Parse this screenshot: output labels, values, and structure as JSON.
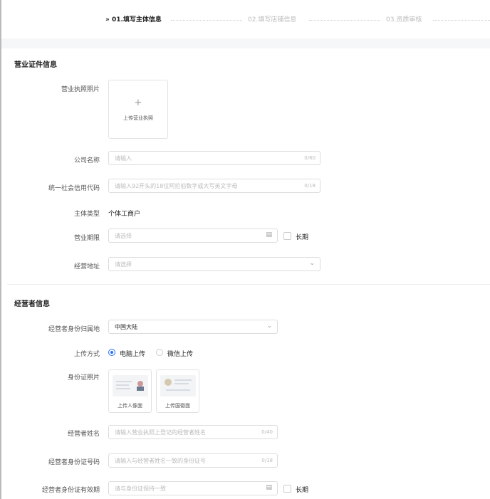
{
  "steps": [
    {
      "label": "» 01.填写主体信息"
    },
    {
      "label": "02.填写店铺信息"
    },
    {
      "label": "03.资质审核"
    }
  ],
  "business": {
    "section_title": "营业证件信息",
    "license_photo_label": "营业执照照片",
    "license_upload_plus": "+",
    "license_upload_text": "上传营业执照",
    "company_name_label": "公司名称",
    "company_name_placeholder": "请输入",
    "company_name_count": "0/60",
    "credit_code_label": "统一社会信用代码",
    "credit_code_placeholder": "请输入92开头的18位阿拉伯数字或大写英文字母",
    "credit_code_count": "0/18",
    "entity_type_label": "主体类型",
    "entity_type_value": "个体工商户",
    "term_label": "营业期限",
    "term_placeholder": "请选择",
    "long_term_label": "长期",
    "address_label": "经营地址",
    "address_placeholder": "请选择"
  },
  "operator": {
    "section_title": "经营者信息",
    "id_region_label": "经营者身份归属地",
    "id_region_value": "中国大陆",
    "upload_method_label": "上传方式",
    "upload_pc_label": "电脑上传",
    "upload_wechat_label": "微信上传",
    "id_photo_label": "身份证照片",
    "id_front_text": "上传人像面",
    "id_back_text": "上传国徽面",
    "name_label": "经营者姓名",
    "name_placeholder": "请输入营业执照上登记的经营者姓名",
    "name_count": "0/40",
    "id_number_label": "经营者身份证号码",
    "id_number_placeholder": "请输入与经营者姓名一致的身份证号",
    "id_number_count": "0/18",
    "id_validity_label": "经营者身份证有效期",
    "id_validity_placeholder": "请与身份证保持一致",
    "long_term_label": "长期"
  },
  "icons": {
    "calendar": "calendar-icon",
    "chevron": "chevron-down-icon"
  },
  "colors": {
    "accent": "#2a6fff"
  }
}
